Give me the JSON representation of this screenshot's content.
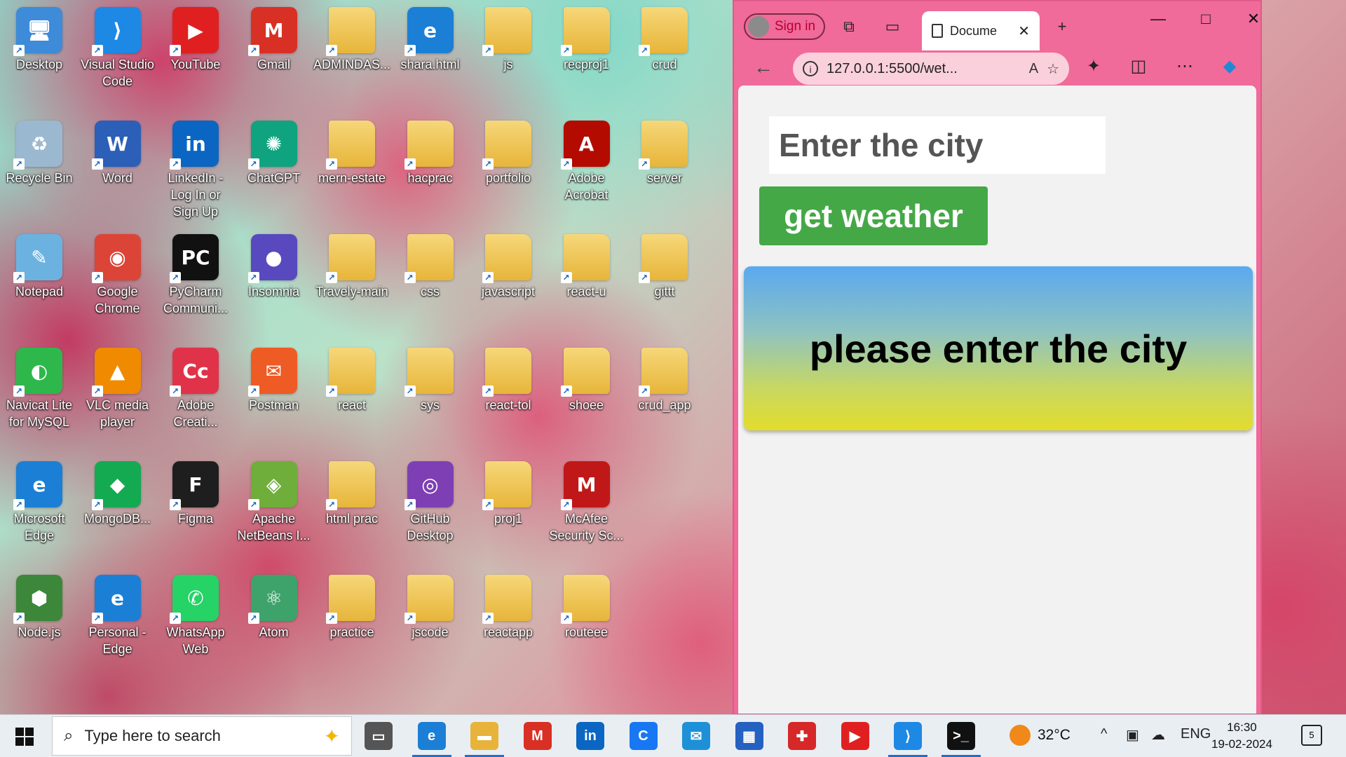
{
  "desktop": {
    "icons": [
      {
        "label": "Desktop",
        "glyph": "🖥",
        "color": "#3d8bd9",
        "col": 0,
        "row": 0
      },
      {
        "label": "Visual Studio Code",
        "glyph": "⟩",
        "color": "#1e88e5",
        "col": 1,
        "row": 0
      },
      {
        "label": "YouTube",
        "glyph": "▶",
        "color": "#e02020",
        "col": 2,
        "row": 0
      },
      {
        "label": "Gmail",
        "glyph": "M",
        "color": "#d93025",
        "col": 3,
        "row": 0
      },
      {
        "label": "ADMINDAS...",
        "glyph": "",
        "color": "folder",
        "col": 4,
        "row": 0
      },
      {
        "label": "shara.html",
        "glyph": "e",
        "color": "#1b7fd6",
        "col": 5,
        "row": 0
      },
      {
        "label": "js",
        "glyph": "",
        "color": "folder",
        "col": 6,
        "row": 0
      },
      {
        "label": "recproj1",
        "glyph": "",
        "color": "folder",
        "col": 7,
        "row": 0
      },
      {
        "label": "crud",
        "glyph": "",
        "color": "folder",
        "col": 8,
        "row": 0
      },
      {
        "label": "Recycle Bin",
        "glyph": "♻",
        "color": "#9bb8d1",
        "col": 0,
        "row": 1
      },
      {
        "label": "Word",
        "glyph": "W",
        "color": "#2b5fb8",
        "col": 1,
        "row": 1
      },
      {
        "label": "LinkedIn - Log In or Sign Up",
        "glyph": "in",
        "color": "#0a66c2",
        "col": 2,
        "row": 1
      },
      {
        "label": "ChatGPT",
        "glyph": "✺",
        "color": "#10a37f",
        "col": 3,
        "row": 1
      },
      {
        "label": "mern-estate",
        "glyph": "",
        "color": "folder",
        "col": 4,
        "row": 1
      },
      {
        "label": "hacprac",
        "glyph": "",
        "color": "folder",
        "col": 5,
        "row": 1
      },
      {
        "label": "portfolio",
        "glyph": "",
        "color": "folder",
        "col": 6,
        "row": 1
      },
      {
        "label": "Adobe Acrobat",
        "glyph": "A",
        "color": "#b30b00",
        "col": 7,
        "row": 1
      },
      {
        "label": "server",
        "glyph": "",
        "color": "folder",
        "col": 8,
        "row": 1
      },
      {
        "label": "Notepad",
        "glyph": "✎",
        "color": "#6cb2e0",
        "col": 0,
        "row": 2
      },
      {
        "label": "Google Chrome",
        "glyph": "◉",
        "color": "#db4437",
        "col": 1,
        "row": 2
      },
      {
        "label": "PyCharm Communi...",
        "glyph": "PC",
        "color": "#111111",
        "col": 2,
        "row": 2
      },
      {
        "label": "Insomnia",
        "glyph": "●",
        "color": "#5849be",
        "col": 3,
        "row": 2
      },
      {
        "label": "Travely-main",
        "glyph": "",
        "color": "folder",
        "col": 4,
        "row": 2
      },
      {
        "label": "css",
        "glyph": "",
        "color": "folder",
        "col": 5,
        "row": 2
      },
      {
        "label": "javascript",
        "glyph": "",
        "color": "folder",
        "col": 6,
        "row": 2
      },
      {
        "label": "react-u",
        "glyph": "",
        "color": "folder",
        "col": 7,
        "row": 2
      },
      {
        "label": "gittt",
        "glyph": "",
        "color": "folder",
        "col": 8,
        "row": 2
      },
      {
        "label": "Navicat Lite for MySQL",
        "glyph": "◐",
        "color": "#2eb84c",
        "col": 0,
        "row": 3
      },
      {
        "label": "VLC media player",
        "glyph": "▲",
        "color": "#f08a00",
        "col": 1,
        "row": 3
      },
      {
        "label": "Adobe Creati...",
        "glyph": "Cc",
        "color": "#e0334a",
        "col": 2,
        "row": 3
      },
      {
        "label": "Postman",
        "glyph": "✉",
        "color": "#ef5b25",
        "col": 3,
        "row": 3
      },
      {
        "label": "react",
        "glyph": "",
        "color": "folder",
        "col": 4,
        "row": 3
      },
      {
        "label": "sys",
        "glyph": "",
        "color": "folder",
        "col": 5,
        "row": 3
      },
      {
        "label": "react-tol",
        "glyph": "",
        "color": "folder",
        "col": 6,
        "row": 3
      },
      {
        "label": "shoee",
        "glyph": "",
        "color": "folder",
        "col": 7,
        "row": 3
      },
      {
        "label": "crud_app",
        "glyph": "",
        "color": "folder",
        "col": 8,
        "row": 3
      },
      {
        "label": "Microsoft Edge",
        "glyph": "e",
        "color": "#1b7fd6",
        "col": 0,
        "row": 4
      },
      {
        "label": "MongoDB...",
        "glyph": "◆",
        "color": "#13aa52",
        "col": 1,
        "row": 4
      },
      {
        "label": "Figma",
        "glyph": "F",
        "color": "#1e1e1e",
        "col": 2,
        "row": 4
      },
      {
        "label": "Apache NetBeans I...",
        "glyph": "◈",
        "color": "#6fae3a",
        "col": 3,
        "row": 4
      },
      {
        "label": "html prac",
        "glyph": "",
        "color": "folder",
        "col": 4,
        "row": 4
      },
      {
        "label": "GitHub Desktop",
        "glyph": "◎",
        "color": "#7e3fb5",
        "col": 5,
        "row": 4
      },
      {
        "label": "proj1",
        "glyph": "",
        "color": "folder",
        "col": 6,
        "row": 4
      },
      {
        "label": "McAfee Security Sc...",
        "glyph": "M",
        "color": "#c01818",
        "col": 7,
        "row": 4
      },
      {
        "label": "Node.js",
        "glyph": "⬢",
        "color": "#3c873a",
        "col": 0,
        "row": 5
      },
      {
        "label": "Personal - Edge",
        "glyph": "e",
        "color": "#1b7fd6",
        "col": 1,
        "row": 5
      },
      {
        "label": "WhatsApp Web",
        "glyph": "✆",
        "color": "#25d366",
        "col": 2,
        "row": 5
      },
      {
        "label": "Atom",
        "glyph": "⚛",
        "color": "#3ea36b",
        "col": 3,
        "row": 5
      },
      {
        "label": "practice",
        "glyph": "",
        "color": "folder",
        "col": 4,
        "row": 5
      },
      {
        "label": "jscode",
        "glyph": "",
        "color": "folder",
        "col": 5,
        "row": 5
      },
      {
        "label": "reactapp",
        "glyph": "",
        "color": "folder",
        "col": 6,
        "row": 5
      },
      {
        "label": "routeee",
        "glyph": "",
        "color": "folder",
        "col": 7,
        "row": 5
      }
    ]
  },
  "browser": {
    "signin_label": "Sign in",
    "tab_title": "Docume",
    "url": "127.0.0.1:5500/wet...",
    "page": {
      "input_placeholder": "Enter the city",
      "button_label": "get weather",
      "message": "please enter the city"
    }
  },
  "taskbar": {
    "search_placeholder": "Type here to search",
    "weather_temp": "32°C",
    "language": "ENG",
    "time": "16:30",
    "date": "19-02-2024",
    "notification_count": "5",
    "pinned": [
      {
        "name": "task-view-icon",
        "glyph": "▭",
        "color": "#555555"
      },
      {
        "name": "edge-taskbar-icon",
        "glyph": "e",
        "color": "#1b7fd6",
        "active": true
      },
      {
        "name": "file-explorer-icon",
        "glyph": "▬",
        "color": "#e8b33a",
        "active": true
      },
      {
        "name": "gmail-taskbar-icon",
        "glyph": "M",
        "color": "#d93025"
      },
      {
        "name": "linkedin-taskbar-icon",
        "glyph": "in",
        "color": "#0a66c2"
      },
      {
        "name": "ccleaner-taskbar-icon",
        "glyph": "C",
        "color": "#1877f2"
      },
      {
        "name": "mail-taskbar-icon",
        "glyph": "✉",
        "color": "#1e90d8"
      },
      {
        "name": "store-taskbar-icon",
        "glyph": "▦",
        "color": "#2561c0"
      },
      {
        "name": "gift-taskbar-icon",
        "glyph": "✚",
        "color": "#d62828"
      },
      {
        "name": "youtube-taskbar-icon",
        "glyph": "▶",
        "color": "#e02020"
      },
      {
        "name": "vscode-taskbar-icon",
        "glyph": "⟩",
        "color": "#1e88e5",
        "active": true
      },
      {
        "name": "terminal-taskbar-icon",
        "glyph": ">_",
        "color": "#111111",
        "active": true
      }
    ]
  }
}
